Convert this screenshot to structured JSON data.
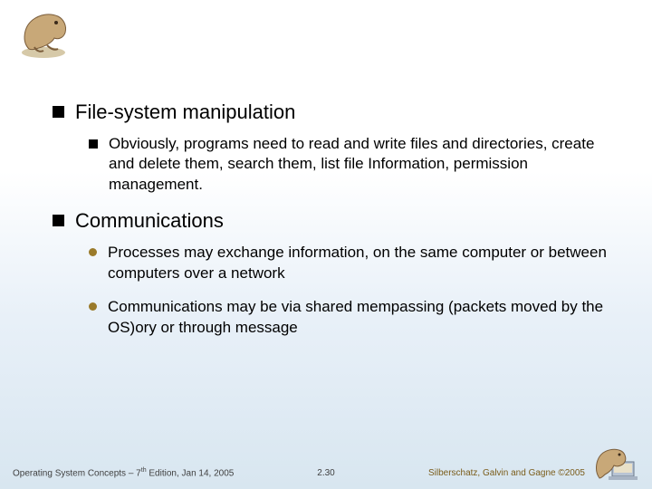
{
  "header": {
    "logo_alt": "dinosaur-illustration"
  },
  "content": {
    "items": [
      {
        "heading": "File-system manipulation",
        "subs": [
          {
            "marker": "square",
            "text": "Obviously, programs need to read and write files and directories, create and delete them, search them, list file Information, permission management."
          }
        ]
      },
      {
        "heading": "Communications",
        "subs": [
          {
            "marker": "dot",
            "text": "Processes may exchange information, on the same computer or between computers over a network"
          },
          {
            "marker": "dot",
            "text": "Communications may be via shared mempassing (packets moved by the OS)ory or through message"
          }
        ]
      }
    ]
  },
  "footer": {
    "left_prefix": "Operating System Concepts – 7",
    "left_super": "th",
    "left_suffix": " Edition, Jan 14, 2005",
    "center": "2.30",
    "right": "Silberschatz, Galvin and Gagne ©2005",
    "logo_alt": "dinosaur-on-computer"
  }
}
